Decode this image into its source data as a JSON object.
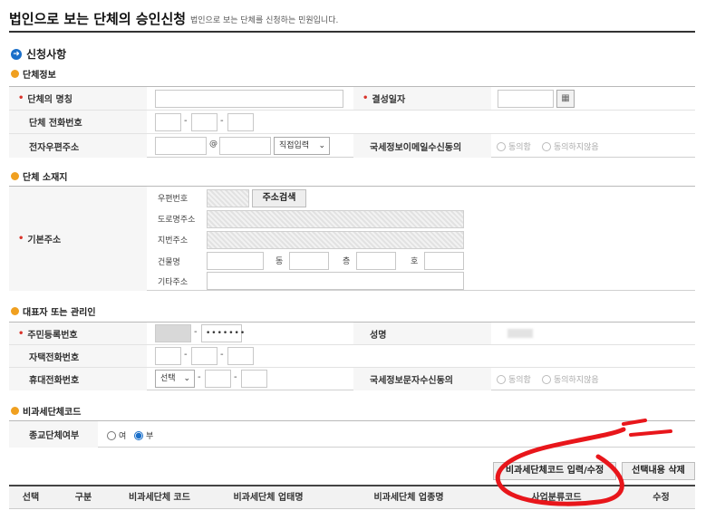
{
  "page": {
    "title": "법인으로 보는 단체의 승인신청",
    "subtitle": "법인으로 보는 단체를 신청하는 민원입니다."
  },
  "sections": {
    "main": "신청사항",
    "group_info": "단체정보",
    "location": "단체 소재지",
    "representative": "대표자 또는 관리인",
    "nontax": "비과세단체코드"
  },
  "group_info": {
    "name_label": "단체의 명칭",
    "founding_date_label": "결성일자",
    "phone_label": "단체 전화번호",
    "email_label": "전자우편주소",
    "email_at": "@",
    "email_domain_select": "직접입력",
    "email_consent_label": "국세정보이메일수신동의",
    "consent_yes": "동의함",
    "consent_no": "동의하지않음",
    "dash": "-"
  },
  "location": {
    "base_address_label": "기본주소",
    "zip_label": "우편번호",
    "address_search_button": "주소검색",
    "road_address_label": "도로명주소",
    "lot_address_label": "지번주소",
    "building_label": "건물명",
    "dong_label": "동",
    "floor_label": "층",
    "ho_label": "호",
    "other_address_label": "기타주소"
  },
  "representative": {
    "rrn_label": "주민등록번호",
    "rrn_masked": "•••••••",
    "name_label": "성명",
    "home_phone_label": "자택전화번호",
    "mobile_label": "휴대전화번호",
    "mobile_prefix_select": "선택",
    "sms_consent_label": "국세정보문자수신동의",
    "consent_yes": "동의함",
    "consent_no": "동의하지않음"
  },
  "nontax": {
    "religious_label": "종교단체여부",
    "option_yes": "여",
    "option_no": "부",
    "selected": "부"
  },
  "actions": {
    "code_input_button": "비과세단체코드 입력/수정",
    "delete_button": "선택내용 삭제"
  },
  "grid": {
    "headers": [
      "선택",
      "구분",
      "비과세단체 코드",
      "비과세단체 업태명",
      "비과세단체 업종명",
      "사업분류코드",
      "수정"
    ]
  },
  "colors": {
    "required_mark": "#d9342b",
    "section_bullet": "#f0a020",
    "main_bullet": "#1a6fc9",
    "annotation": "#e8161b"
  }
}
